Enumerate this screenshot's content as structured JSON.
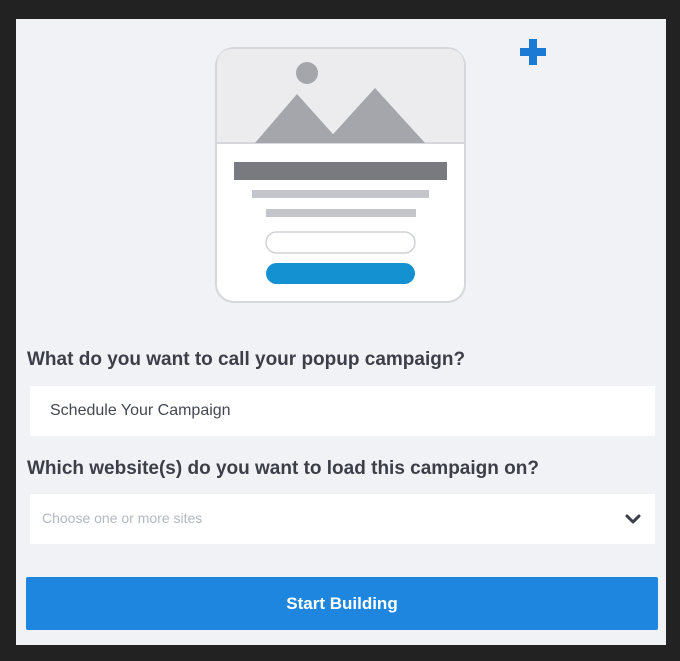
{
  "campaign_form": {
    "name_label": "What do you want to call your popup campaign?",
    "name_value": "Schedule Your Campaign",
    "sites_label": "Which website(s) do you want to load this campaign on?",
    "sites_placeholder": "Choose one or more sites",
    "submit_label": "Start Building"
  },
  "icons": {
    "add": "plus-icon",
    "dropdown": "chevron-down-icon",
    "illustration": "popup-preview-illustration"
  },
  "colors": {
    "accent": "#1e86de",
    "plus": "#1b7ad4",
    "panel_background": "#f1f2f6",
    "label_text": "#3c3f48"
  }
}
